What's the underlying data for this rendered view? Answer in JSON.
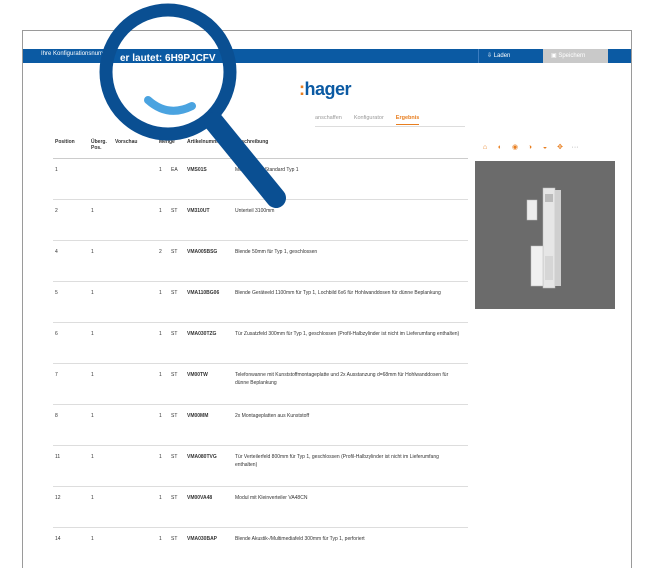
{
  "header": {
    "config_text_prefix": "Ihre Konfigurationsnummer",
    "config_text_zoomed": "er lautet: 6H9PJCFV",
    "load_label": "Laden",
    "save_label": "Speichern"
  },
  "brand": {
    "logo_text": "hager",
    "brand_color": "#0b5aa3",
    "accent_color": "#e87e1f"
  },
  "nav": {
    "tabs": [
      "anschaffen",
      "Konfigurator",
      "Ergebnis"
    ],
    "active": "Ergebnis"
  },
  "table": {
    "columns": [
      "Position",
      "Überg. Pos.",
      "Vorschau",
      "Menge",
      "",
      "Artikelnummer",
      "Beschreibung"
    ],
    "rows": [
      {
        "pos": "1",
        "parent": "",
        "qty": "1",
        "unit": "EA",
        "article": "VMS01S",
        "desc": "Mediensäule Standard Typ 1"
      },
      {
        "pos": "2",
        "parent": "1",
        "qty": "1",
        "unit": "ST",
        "article": "VM310UT",
        "desc": "Unterteil 3100mm"
      },
      {
        "pos": "4",
        "parent": "1",
        "qty": "2",
        "unit": "ST",
        "article": "VMA005BSG",
        "desc": "Blende 50mm für Typ 1, geschlossen"
      },
      {
        "pos": "5",
        "parent": "1",
        "qty": "1",
        "unit": "ST",
        "article": "VMA110BG06",
        "desc": "Blende Geräteeld 1100mm für Typ 1, Lochbild 6x6 für Hohlwanddosen für dünne Beplankung"
      },
      {
        "pos": "6",
        "parent": "1",
        "qty": "1",
        "unit": "ST",
        "article": "VMA030TZG",
        "desc": "Tür Zusatzfeld 300mm für Typ 1, geschlossen (Profil-Halbzylinder ist nicht im Lieferumfang enthalten)"
      },
      {
        "pos": "7",
        "parent": "1",
        "qty": "1",
        "unit": "ST",
        "article": "VM00TW",
        "desc": "Telefonwanne mit Kunststoffmontageplatte und 2x Ausstanzung d=68mm für Hohlwanddosen für dünne Beplankung"
      },
      {
        "pos": "8",
        "parent": "1",
        "qty": "1",
        "unit": "ST",
        "article": "VM00MM",
        "desc": "2x Montageplatten aus Kunststoff"
      },
      {
        "pos": "11",
        "parent": "1",
        "qty": "1",
        "unit": "ST",
        "article": "VMA080TVG",
        "desc": "Tür Verteilerfeld 800mm für Typ 1, geschlossen (Profil-Halbzylinder ist nicht im Lieferumfang enthalten)"
      },
      {
        "pos": "12",
        "parent": "1",
        "qty": "1",
        "unit": "ST",
        "article": "VM00VA48",
        "desc": "Modul mit Kleinverteiler VA48CN"
      },
      {
        "pos": "14",
        "parent": "1",
        "qty": "1",
        "unit": "ST",
        "article": "VMA030BAP",
        "desc": "Blende Akustik-/Multimediafeld 300mm für Typ 1, perforiert"
      }
    ]
  },
  "viewer_tools": [
    "home-icon",
    "rotate-left-icon",
    "zoom-icon",
    "rotate-right-icon",
    "rotate-icon",
    "move-icon",
    "more-icon"
  ]
}
